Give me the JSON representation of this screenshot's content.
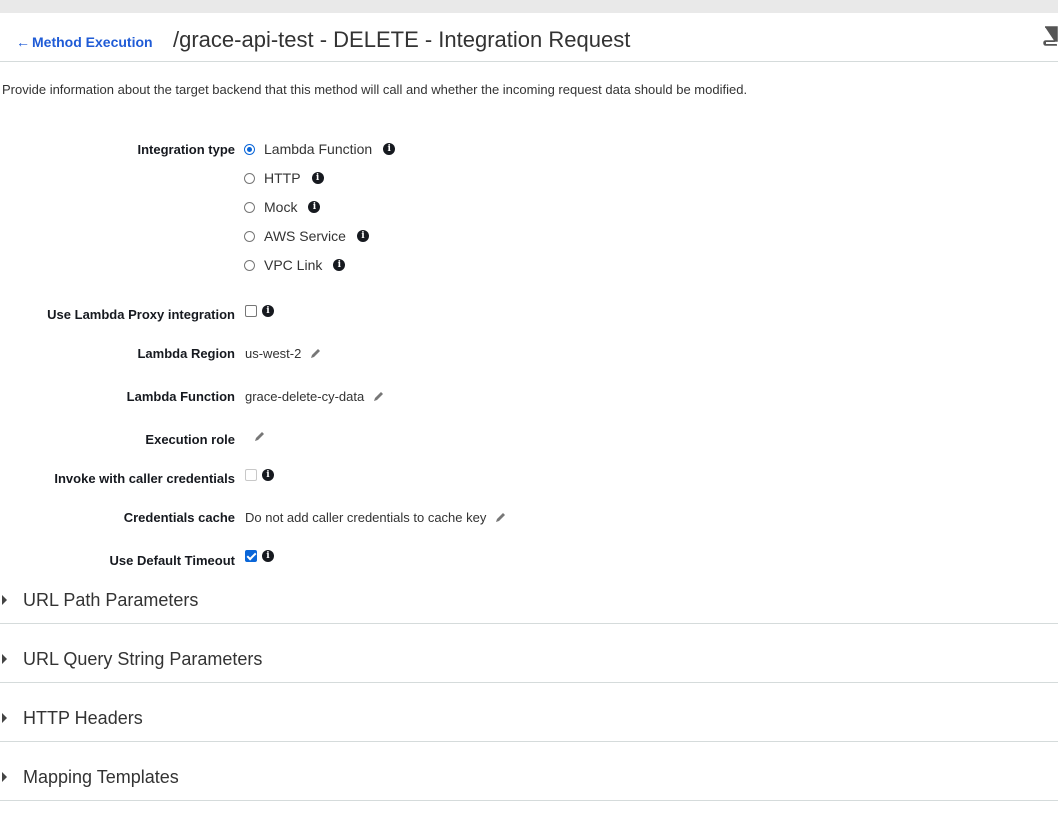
{
  "header": {
    "back_label": "Method Execution",
    "title": "/grace-api-test - DELETE - Integration Request",
    "help_icon": "book-icon"
  },
  "description": "Provide information about the target backend that this method will call and whether the incoming request data should be modified.",
  "integration_type": {
    "label": "Integration type",
    "selected": "Lambda Function",
    "options": [
      {
        "label": "Lambda Function",
        "checked": true
      },
      {
        "label": "HTTP",
        "checked": false
      },
      {
        "label": "Mock",
        "checked": false
      },
      {
        "label": "AWS Service",
        "checked": false
      },
      {
        "label": "VPC Link",
        "checked": false
      }
    ]
  },
  "proxy": {
    "label": "Use Lambda Proxy integration",
    "checked": false
  },
  "region": {
    "label": "Lambda Region",
    "value": "us-west-2"
  },
  "function": {
    "label": "Lambda Function",
    "value": "grace-delete-cy-data"
  },
  "execution_role": {
    "label": "Execution role",
    "value": ""
  },
  "invoke_caller": {
    "label": "Invoke with caller credentials",
    "checked": false,
    "disabled": true
  },
  "cred_cache": {
    "label": "Credentials cache",
    "value": "Do not add caller credentials to cache key"
  },
  "default_timeout": {
    "label": "Use Default Timeout",
    "checked": true
  },
  "sections": [
    {
      "title": "URL Path Parameters"
    },
    {
      "title": "URL Query String Parameters"
    },
    {
      "title": "HTTP Headers"
    },
    {
      "title": "Mapping Templates"
    }
  ],
  "colors": {
    "accent": "#0a66d8",
    "link": "#1f5bd6",
    "border": "#d5dbdb"
  }
}
